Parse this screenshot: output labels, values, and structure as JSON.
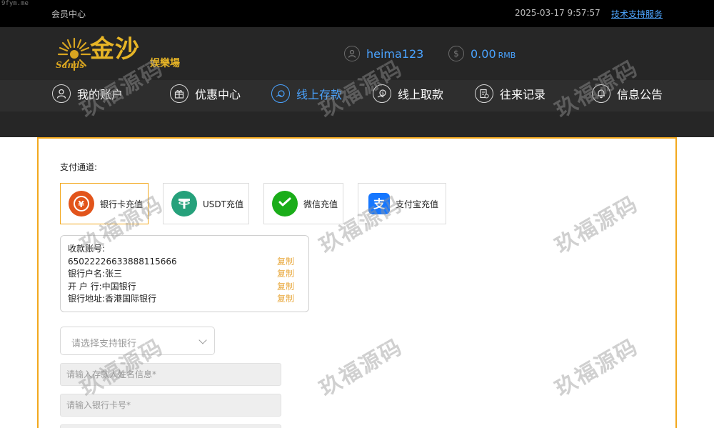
{
  "site_tag": "9fym.me",
  "topbar": {
    "member_center": "会员中心",
    "datetime": "2025-03-17 9:57:57",
    "support_link": "技术支持服务"
  },
  "logo": {
    "sands": "Sands",
    "cn": "金沙",
    "sub": "娱樂場"
  },
  "user": {
    "username": "heima123",
    "balance": "0.00",
    "currency": "RMB"
  },
  "nav": {
    "items": [
      {
        "label": "我的账户",
        "icon": "user-icon"
      },
      {
        "label": "优惠中心",
        "icon": "gift-icon"
      },
      {
        "label": "线上存款",
        "icon": "deposit-icon",
        "active": true
      },
      {
        "label": "线上取款",
        "icon": "withdraw-icon"
      },
      {
        "label": "往来记录",
        "icon": "records-icon"
      },
      {
        "label": "信息公告",
        "icon": "bell-icon"
      }
    ]
  },
  "payment": {
    "label": "支付通道:",
    "options": [
      {
        "label": "银行卡充值",
        "icon": "bank-card-icon",
        "color": "#e2541b",
        "active": true
      },
      {
        "label": "USDT充值",
        "icon": "usdt-icon",
        "color": "#26a17b"
      },
      {
        "label": "微信充值",
        "icon": "wechat-icon",
        "color": "#1aad19"
      },
      {
        "label": "支付宝充值",
        "icon": "alipay-icon",
        "color": "#1677ff"
      }
    ]
  },
  "account": {
    "title": "收款账号:",
    "number": "6502222663388811566​6",
    "holder": "银行户名:张三",
    "bank": "开 户 行:中国银行",
    "address": "银行地址:香港国际银行",
    "copy_label": "复制"
  },
  "form": {
    "bank_select_placeholder": "请选择支持银行",
    "name_placeholder": "请输入存款人姓名信息*",
    "card_placeholder": "请输入银行卡号*"
  },
  "watermark": "玖福源码",
  "colors": {
    "accent_blue": "#4aa3ff",
    "accent_orange": "#f2a81d",
    "copy_orange": "#e8a73a",
    "header_bg": "#262626",
    "topbar_bg": "#000000"
  }
}
